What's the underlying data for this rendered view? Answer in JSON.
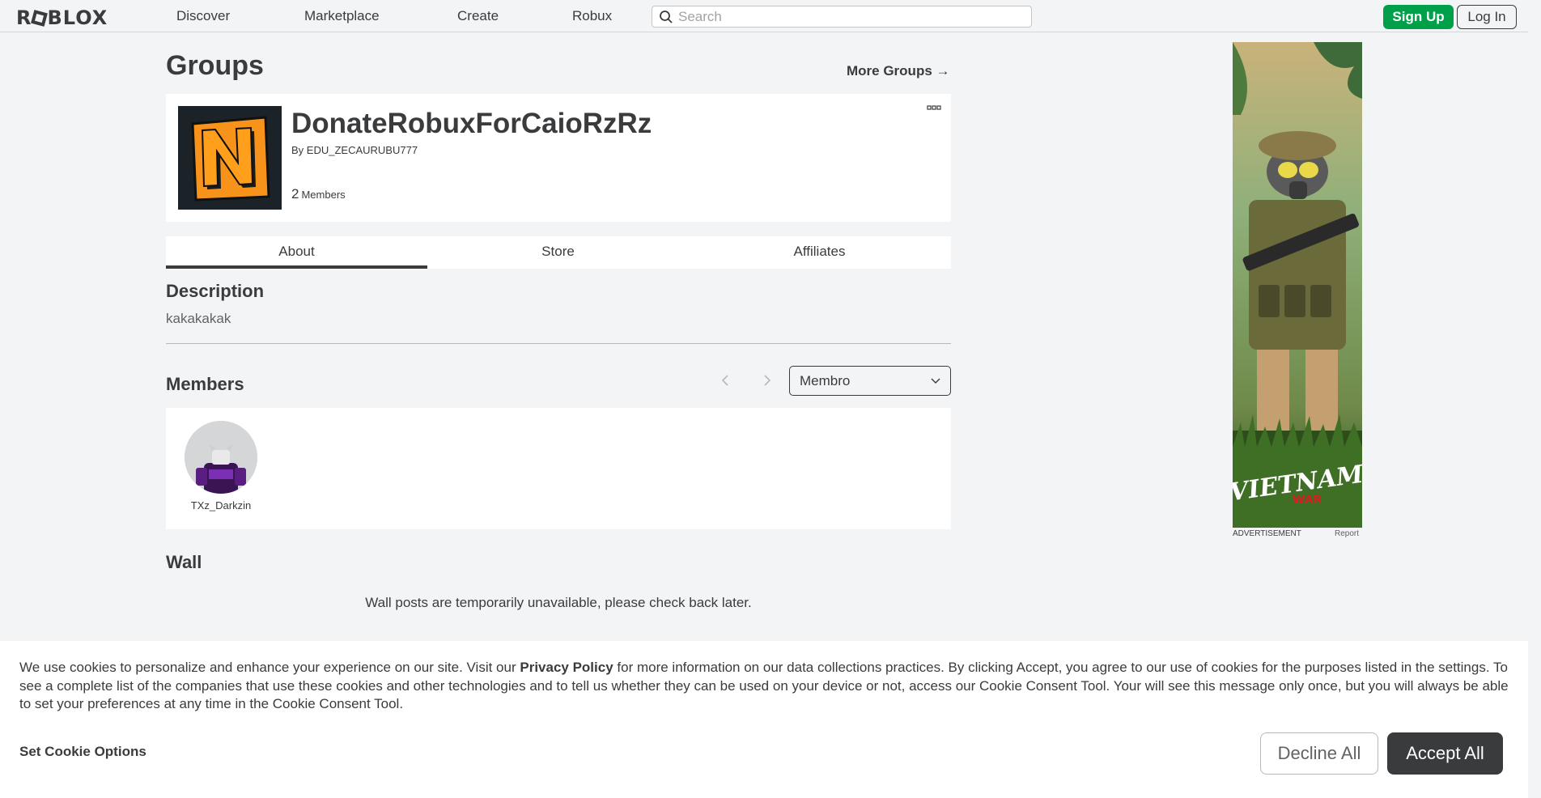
{
  "nav": {
    "logo": "ROBLOX",
    "links": [
      "Discover",
      "Marketplace",
      "Create",
      "Robux"
    ],
    "search_placeholder": "Search",
    "signup": "Sign Up",
    "login": "Log In"
  },
  "page": {
    "title": "Groups",
    "more_groups": "More Groups →"
  },
  "group": {
    "name": "DonateRobuxForCaioRzRz",
    "owner_prefix": "By",
    "owner": "EDU_ZECAURUBU777",
    "member_count": "2",
    "member_label": "Members",
    "emblem_letter": "N"
  },
  "tabs": [
    "About",
    "Store",
    "Affiliates"
  ],
  "description": {
    "heading": "Description",
    "text": "kakakakak"
  },
  "members": {
    "heading": "Members",
    "role_selected": "Membro",
    "list": [
      {
        "username": "TXz_Darkzin"
      }
    ]
  },
  "wall": {
    "heading": "Wall",
    "message": "Wall posts are temporarily unavailable, please check back later."
  },
  "ad": {
    "label": "ADVERTISEMENT",
    "report": "Report",
    "logo_text": "VIETNAM",
    "logo_sub": "WAR"
  },
  "cookie": {
    "text_before": "We use cookies to personalize and enhance your experience on our site. Visit our ",
    "privacy_link": "Privacy Policy",
    "text_after": " for more information on our data collections practices. By clicking Accept, you agree to our use of cookies for the purposes listed in the settings. To see a complete list of the companies that use these cookies and other technologies and to tell us whether they can be used on your device or not, access our Cookie Consent Tool. Your will see this message only once, but you will always be able to set your preferences at any time in the Cookie Consent Tool.",
    "set_options": "Set Cookie Options",
    "decline": "Decline All",
    "accept": "Accept All"
  },
  "colors": {
    "background": "#f2f4f5",
    "signup_green": "#00a04a",
    "text_dark": "#393b3d",
    "emblem_orange": "#f7931a"
  }
}
